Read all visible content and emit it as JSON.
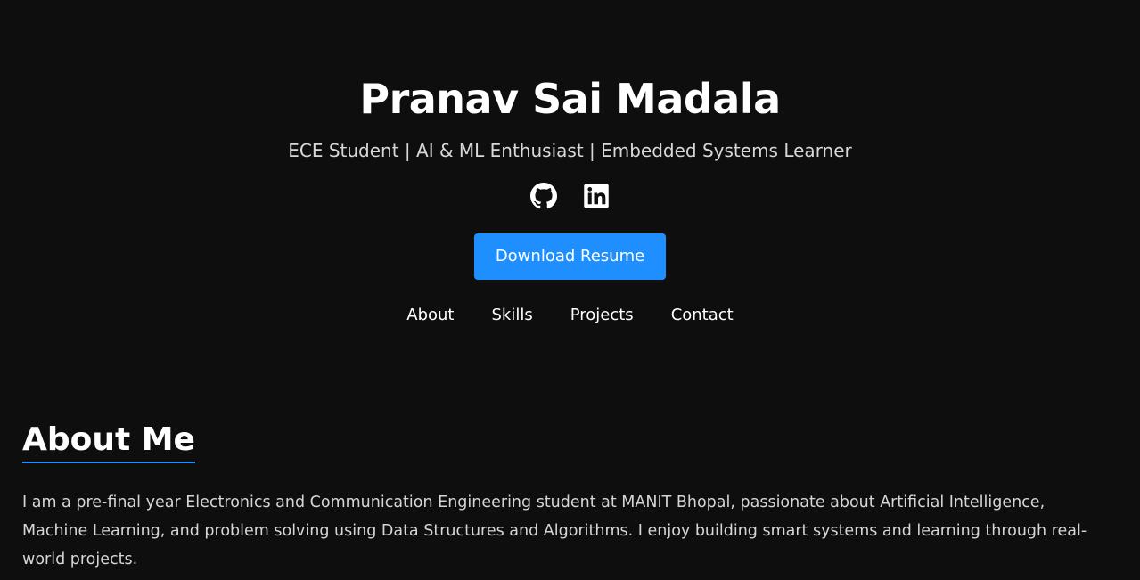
{
  "header": {
    "name": "Pranav Sai Madala",
    "tagline": "ECE Student | AI & ML Enthusiast | Embedded Systems Learner"
  },
  "socials": [
    {
      "icon": "github-icon",
      "label": "GitHub"
    },
    {
      "icon": "linkedin-icon",
      "label": "LinkedIn"
    }
  ],
  "resume_button": {
    "label": "Download Resume"
  },
  "nav": {
    "items": [
      {
        "label": "About"
      },
      {
        "label": "Skills"
      },
      {
        "label": "Projects"
      },
      {
        "label": "Contact"
      }
    ]
  },
  "about": {
    "title": "About Me",
    "text": "I am a pre-final year Electronics and Communication Engineering student at MANIT Bhopal, passionate about Artificial Intelligence, Machine Learning, and problem solving using Data Structures and Algorithms. I enjoy building smart systems and learning through real-world projects."
  },
  "colors": {
    "background": "#0e0e0f",
    "accent": "#1f8fff",
    "text": "#ffffff"
  }
}
